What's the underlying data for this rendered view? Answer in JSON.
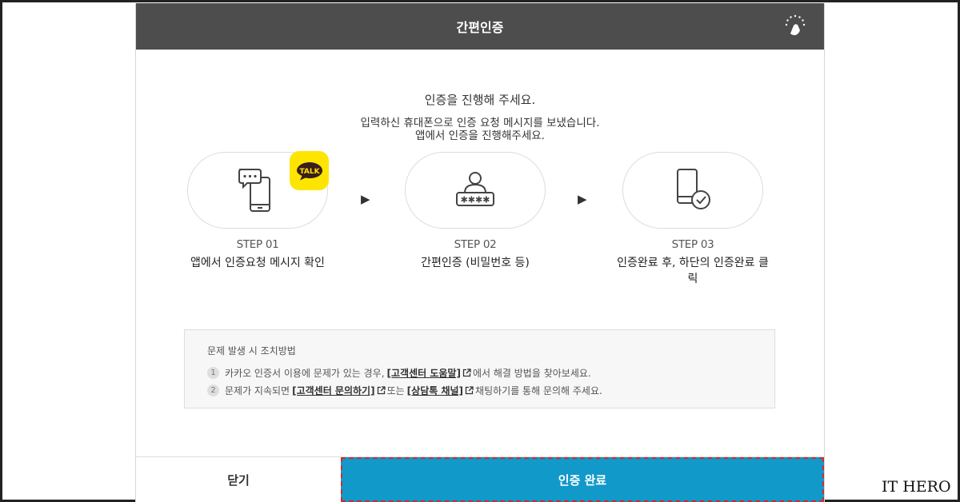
{
  "header": {
    "title": "간편인증",
    "logo_icon": "kakao-cert-logo-icon"
  },
  "intro": {
    "title": "인증을 진행해 주세요.",
    "desc_line1": "입력하신 휴대폰으로 인증 요청 메시지를 보냈습니다.",
    "desc_line2": "앱에서 인증을 진행해주세요."
  },
  "steps": [
    {
      "label": "STEP 01",
      "desc": "앱에서 인증요청 메시지 확인",
      "icon": "phone-message-icon"
    },
    {
      "label": "STEP 02",
      "desc": "간편인증 (비밀번호 등)",
      "icon": "user-password-icon"
    },
    {
      "label": "STEP 03",
      "desc": "인증완료 후, 하단의 인증완료 클릭",
      "icon": "phone-check-icon"
    }
  ],
  "badge": {
    "text": "TALK",
    "color": "#fee500"
  },
  "arrow_glyph": "▶",
  "help": {
    "title": "문제 발생 시 조치방법",
    "items": [
      {
        "num": "1",
        "pre": "카카오 인증서 이용에 문제가 있는 경우,",
        "link": "[고객센터 도움말]",
        "post": "에서 해결 방법을 찾아보세요."
      },
      {
        "num": "2",
        "pre": "문제가 지속되면",
        "link": "[고객센터 문의하기]",
        "mid": "또는",
        "link2": "[상담톡 채널]",
        "post": "채팅하기를 통해 문의해 주세요."
      }
    ]
  },
  "footer": {
    "close_label": "닫기",
    "confirm_label": "인증 완료",
    "confirm_color": "#1199c9"
  },
  "watermark": "IT HERO"
}
